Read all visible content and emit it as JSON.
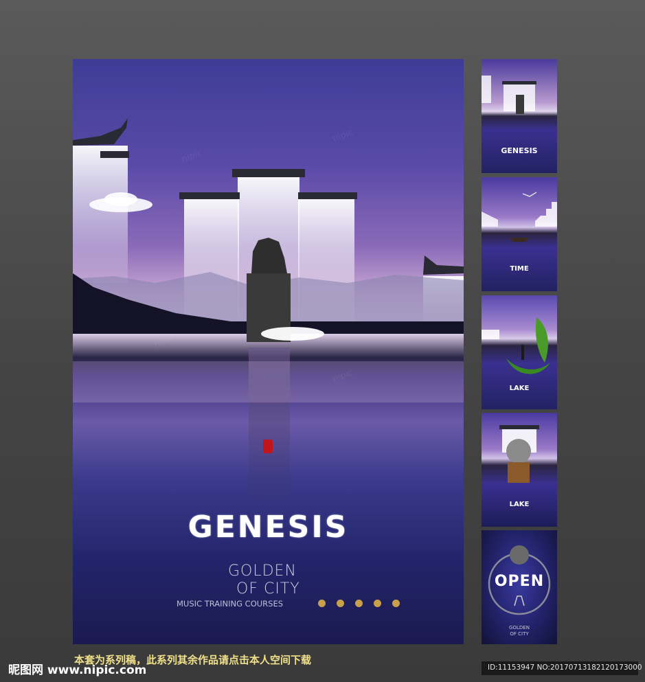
{
  "main_poster": {
    "title": "GENESIS",
    "line1": "GOLDEN",
    "line2": "OF CITY",
    "line3": "MUSIC TRAINING COURSES"
  },
  "thumbnails": [
    {
      "label": "GENESIS"
    },
    {
      "label": "TIME"
    },
    {
      "label": "LAKE"
    },
    {
      "label": "LAKE"
    },
    {
      "label": "OPEN",
      "sub1": "GOLDEN",
      "sub2": "OF CITY"
    }
  ],
  "footer": {
    "note": "本套为系列稿，此系列其余作品请点击本人空间下载",
    "logo": "昵图网 www.nipic.com",
    "id_text": "ID:11153947 NO:20170713182120173000"
  },
  "colors": {
    "accent_gold": "#c8a04a",
    "seal_red": "#c0161b",
    "note_yellow": "#f0e08a"
  }
}
